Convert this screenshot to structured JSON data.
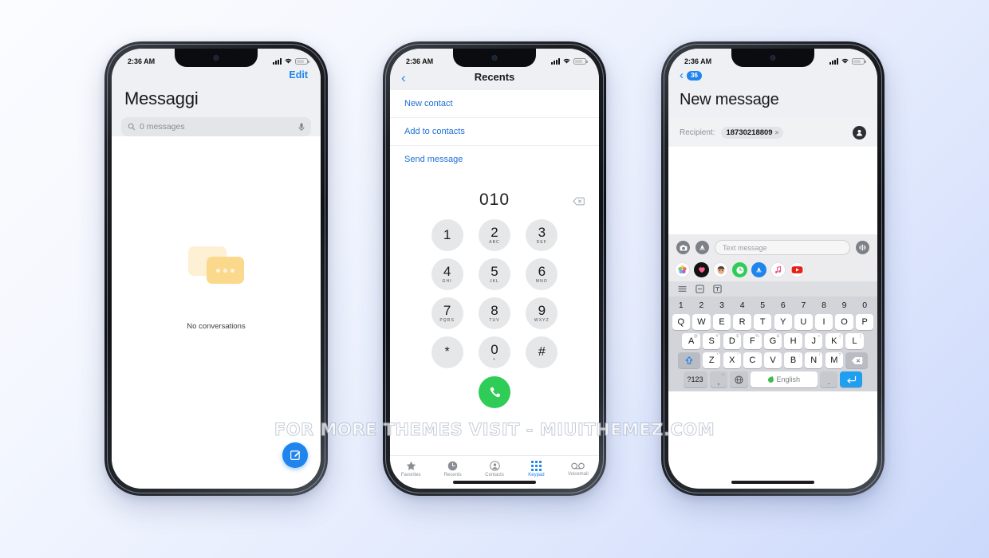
{
  "watermark": "FOR MORE THEMES VISIT - MIUITHEMEZ.COM",
  "status_bar": {
    "time": "2:36 AM"
  },
  "colors": {
    "accent_blue": "#1f84ec",
    "call_green": "#2fcc58",
    "bubble_amber": "#fbd98c",
    "bubble_cream": "#fdf0d4"
  },
  "phone1": {
    "edit_label": "Edit",
    "title": "Messaggi",
    "search_placeholder": "0 messages",
    "search_icon": "magnifier-icon",
    "mic_icon": "microphone-icon",
    "empty_state_text": "No conversations",
    "compose_icon": "compose-pencil-icon"
  },
  "phone2": {
    "nav_title": "Recents",
    "back_icon": "chevron-left-icon",
    "actions": [
      "New contact",
      "Add to contacts",
      "Send message"
    ],
    "dialed_number": "010",
    "backspace_icon": "backspace-icon",
    "keys": [
      {
        "digit": "1",
        "letters": ""
      },
      {
        "digit": "2",
        "letters": "ABC"
      },
      {
        "digit": "3",
        "letters": "DEF"
      },
      {
        "digit": "4",
        "letters": "GHI"
      },
      {
        "digit": "5",
        "letters": "JKL"
      },
      {
        "digit": "6",
        "letters": "MNO"
      },
      {
        "digit": "7",
        "letters": "PQRS"
      },
      {
        "digit": "8",
        "letters": "TUV"
      },
      {
        "digit": "9",
        "letters": "WXYZ"
      },
      {
        "digit": "*",
        "letters": ""
      },
      {
        "digit": "0",
        "letters": "+"
      },
      {
        "digit": "#",
        "letters": ""
      }
    ],
    "call_icon": "phone-handset-icon",
    "tabs": [
      {
        "label": "Favorites",
        "icon": "star-icon",
        "active": false
      },
      {
        "label": "Recents",
        "icon": "clock-icon",
        "active": false
      },
      {
        "label": "Contacts",
        "icon": "person-circle-icon",
        "active": false
      },
      {
        "label": "Keypad",
        "icon": "keypad-grid-icon",
        "active": true
      },
      {
        "label": "Voicemail",
        "icon": "voicemail-icon",
        "active": false
      }
    ]
  },
  "phone3": {
    "back_icon": "chevron-left-icon",
    "back_badge": "36",
    "title": "New message",
    "recipient_label": "Recipient:",
    "recipient_value": "18730218809",
    "chip_remove_icon": "close-x-icon",
    "contact_icon": "contact-avatar-icon",
    "camera_icon": "camera-icon",
    "appstore_icon": "app-store-icon",
    "text_placeholder": "Text message",
    "audio_icon": "audio-waveform-icon",
    "app_strip": [
      "photos-icon",
      "music-heart-icon",
      "memoji-icon",
      "clock-green-icon",
      "app-store-blue-icon",
      "music-note-icon",
      "youtube-icon"
    ],
    "keyboard": {
      "toolbar_icons": [
        "menu-lines-icon",
        "clipboard-icon",
        "text-format-icon"
      ],
      "number_row": [
        "1",
        "2",
        "3",
        "4",
        "5",
        "6",
        "7",
        "8",
        "9",
        "0"
      ],
      "row1": [
        {
          "key": "Q",
          "alt": ""
        },
        {
          "key": "W",
          "alt": ""
        },
        {
          "key": "E",
          "alt": ""
        },
        {
          "key": "R",
          "alt": ""
        },
        {
          "key": "T",
          "alt": ""
        },
        {
          "key": "Y",
          "alt": ""
        },
        {
          "key": "U",
          "alt": ""
        },
        {
          "key": "I",
          "alt": ""
        },
        {
          "key": "O",
          "alt": ""
        },
        {
          "key": "P",
          "alt": ""
        }
      ],
      "row2": [
        {
          "key": "A",
          "alt": "@"
        },
        {
          "key": "S",
          "alt": "#"
        },
        {
          "key": "D",
          "alt": "$"
        },
        {
          "key": "F",
          "alt": "%"
        },
        {
          "key": "G",
          "alt": "&"
        },
        {
          "key": "H",
          "alt": "-"
        },
        {
          "key": "J",
          "alt": "+"
        },
        {
          "key": "K",
          "alt": "("
        },
        {
          "key": "L",
          "alt": ")"
        }
      ],
      "row3": [
        {
          "key": "Z",
          "alt": "*"
        },
        {
          "key": "X",
          "alt": "\""
        },
        {
          "key": "C",
          "alt": "'"
        },
        {
          "key": "V",
          "alt": ":"
        },
        {
          "key": "B",
          "alt": ";"
        },
        {
          "key": "N",
          "alt": "!"
        },
        {
          "key": "M",
          "alt": "?"
        }
      ],
      "shift_icon": "shift-arrow-icon",
      "backspace_icon": "backspace-icon",
      "symbols_label": "?123",
      "comma_key": ",",
      "comma_alt": "☺",
      "globe_icon": "globe-icon",
      "space_label": "English",
      "period_key": ".",
      "period_alt": "\u0000",
      "enter_icon": "enter-return-icon"
    }
  }
}
